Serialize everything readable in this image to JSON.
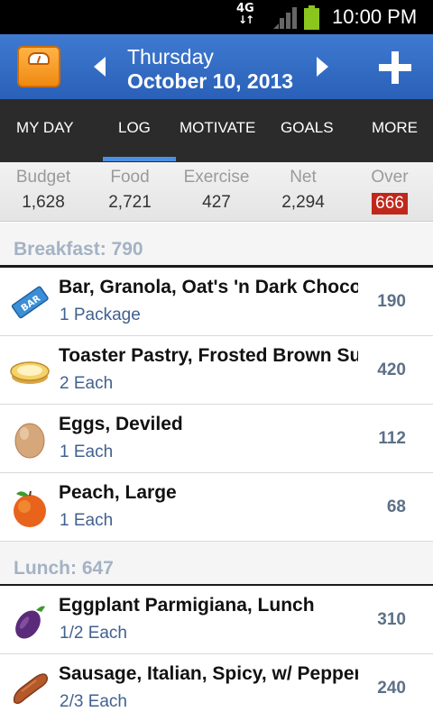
{
  "status": {
    "network": "4G",
    "time": "10:00 PM"
  },
  "header": {
    "day": "Thursday",
    "date": "October 10, 2013"
  },
  "tabs": [
    {
      "label": "MY DAY"
    },
    {
      "label": "LOG",
      "active": true
    },
    {
      "label": "MOTIVATE"
    },
    {
      "label": "GOALS"
    },
    {
      "label": "MORE"
    }
  ],
  "summary": {
    "budget": {
      "label": "Budget",
      "value": "1,628"
    },
    "food": {
      "label": "Food",
      "value": "2,721"
    },
    "exercise": {
      "label": "Exercise",
      "value": "427"
    },
    "net": {
      "label": "Net",
      "value": "2,294"
    },
    "over": {
      "label": "Over",
      "value": "666"
    }
  },
  "colors": {
    "header_blue": "#2f67c0",
    "tab_accent": "#4a90e2",
    "over_red": "#c0281c",
    "meal_title": "#a4b2c4",
    "quantity_blue": "#41618f"
  },
  "meals": [
    {
      "title": "Breakfast: 790",
      "items": [
        {
          "name": "Bar, Granola, Oat's 'n Dark Chocolate",
          "quantity": "1 Package",
          "calories": "190",
          "icon": "granola-bar-icon"
        },
        {
          "name": "Toaster Pastry, Frosted Brown Sugar",
          "quantity": "2 Each",
          "calories": "420",
          "icon": "toaster-pastry-icon"
        },
        {
          "name": "Eggs, Deviled",
          "quantity": "1 Each",
          "calories": "112",
          "icon": "egg-icon"
        },
        {
          "name": "Peach, Large",
          "quantity": "1 Each",
          "calories": "68",
          "icon": "peach-icon"
        }
      ]
    },
    {
      "title": "Lunch: 647",
      "items": [
        {
          "name": "Eggplant Parmigiana, Lunch",
          "quantity": "1/2 Each",
          "calories": "310",
          "icon": "eggplant-icon"
        },
        {
          "name": "Sausage, Italian, Spicy, w/ Peppers",
          "quantity": "2/3 Each",
          "calories": "240",
          "icon": "sausage-icon"
        }
      ]
    }
  ]
}
